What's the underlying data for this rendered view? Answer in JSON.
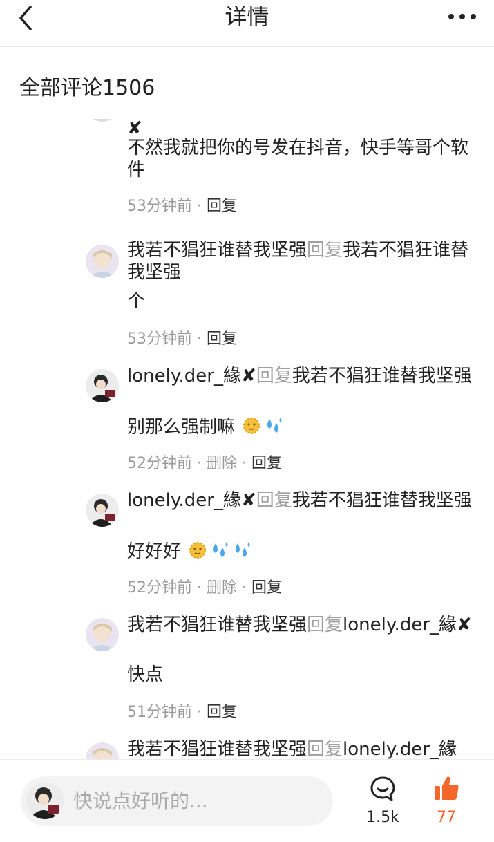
{
  "header": {
    "title": "详情"
  },
  "comments_header": {
    "label": "全部评论1506"
  },
  "replies": [
    {
      "username": "",
      "reply_word": "",
      "target": "",
      "first_line": "✘",
      "content": "不然我就把你的号发在抖音，快手等哥个软件",
      "time": "53分钟前",
      "reply_label": "回复"
    },
    {
      "username": "我若不猖狂谁替我坚强",
      "reply_word": "回复",
      "target": "我若不猖狂谁替我坚强",
      "content": "个",
      "time": "53分钟前",
      "reply_label": "回复"
    },
    {
      "username": "lonely.der_緣✘",
      "reply_word": "回复",
      "target": "我若不猖狂谁替我坚强",
      "content": "别那么强制嘛",
      "time": "52分钟前",
      "delete_label": "删除",
      "reply_label": "回复"
    },
    {
      "username": "lonely.der_緣✘",
      "reply_word": "回复",
      "target": "我若不猖狂谁替我坚强",
      "content": "好好好",
      "time": "52分钟前",
      "delete_label": "删除",
      "reply_label": "回复"
    },
    {
      "username": "我若不猖狂谁替我坚强",
      "reply_word": "回复",
      "target": "lonely.der_緣✘",
      "content": "快点",
      "time": "51分钟前",
      "reply_label": "回复"
    },
    {
      "username": "我若不猖狂谁替我坚强",
      "reply_word": "回复",
      "target": "lonely.der_緣"
    }
  ],
  "bottom_bar": {
    "placeholder": "快说点好听的...",
    "comment_count": "1.5k",
    "like_count": "77",
    "like_color": "#f4672b"
  },
  "icons": {
    "back": "chevron-left-icon",
    "more": "more-dots-icon",
    "comment": "comment-bubble-icon",
    "like": "thumbs-up-icon",
    "emoji_sun": "sun-face-emoji",
    "emoji_sweat": "sweat-droplets-emoji"
  }
}
